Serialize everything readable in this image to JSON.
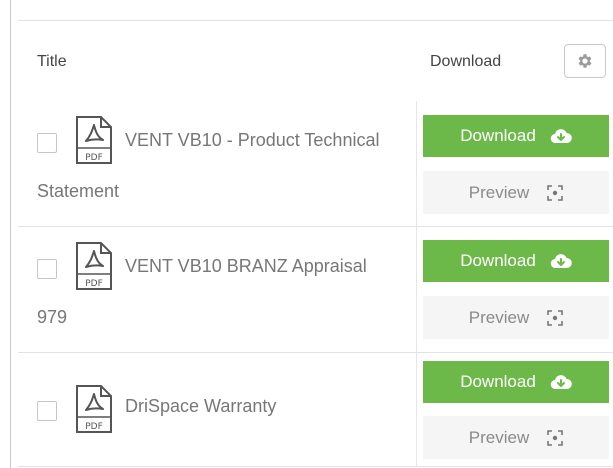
{
  "table": {
    "headers": {
      "title": "Title",
      "download": "Download"
    },
    "rows": [
      {
        "title_line1": "VENT VB10 - Product Technical",
        "title_line2": "Statement",
        "download_label": "Download",
        "preview_label": "Preview"
      },
      {
        "title_line1": "VENT VB10 BRANZ Appraisal",
        "title_line2": "979",
        "download_label": "Download",
        "preview_label": "Preview"
      },
      {
        "title_line1": "DriSpace Warranty",
        "title_line2": "",
        "download_label": "Download",
        "preview_label": "Preview"
      }
    ]
  },
  "icons": {
    "settings": "gear-icon",
    "file": "pdf-file-icon",
    "download": "cloud-download-icon",
    "preview": "focus-preview-icon"
  },
  "colors": {
    "download_button": "#6cb94a",
    "preview_button": "#f5f5f5",
    "border": "#e3e3e3",
    "title_text": "#777777"
  }
}
